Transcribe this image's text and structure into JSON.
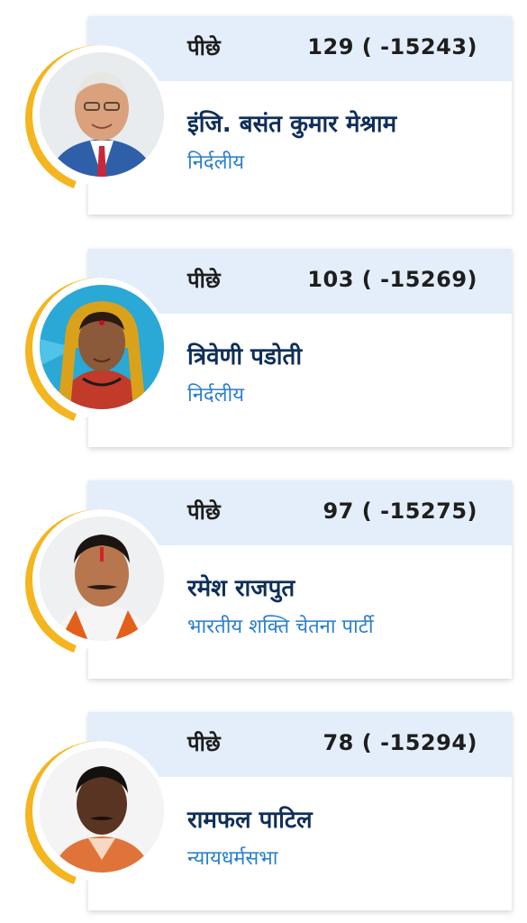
{
  "candidates": [
    {
      "status": "पीछे",
      "votes": "129 ( -15243)",
      "name": "इंजि. बसंत कुमार मेश्राम",
      "party": "निर्दलीय",
      "photo_icon": "person-photo-man-suit"
    },
    {
      "status": "पीछे",
      "votes": "103 ( -15269)",
      "name": "त्रिवेणी पडोती",
      "party": "निर्दलीय",
      "photo_icon": "person-photo-woman-saree"
    },
    {
      "status": "पीछे",
      "votes": "97 ( -15275)",
      "name": "रमेश राजपुत",
      "party": "भारतीय शक्ति चेतना पार्टी",
      "photo_icon": "person-photo-man-tilak"
    },
    {
      "status": "पीछे",
      "votes": "78 ( -15294)",
      "name": "रामफल पाटिल",
      "party": "न्यायधर्मसभा",
      "photo_icon": "person-photo-man-orange-scarf"
    }
  ],
  "colors": {
    "header_bg": "#e3eefa",
    "name_color": "#0f2f5a",
    "party_color": "#2a7fce",
    "ring_color": "#f4b51e"
  }
}
